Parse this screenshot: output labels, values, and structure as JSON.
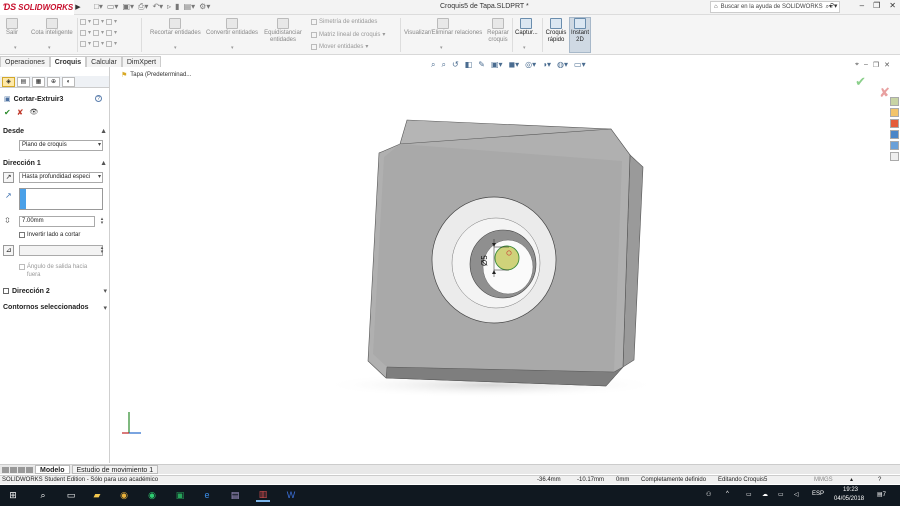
{
  "app": {
    "brand": "SOLIDWORKS",
    "document_title": "Croquis5 de Tapa.SLDPRT *",
    "help_search_placeholder": "Buscar en la ayuda de SOLIDWORKS"
  },
  "ribbon": {
    "buttons": [
      {
        "label": "Salir"
      },
      {
        "label": "Cota inteligente"
      },
      {
        "label": "Recortar entidades"
      },
      {
        "label": "Convertir entidades"
      },
      {
        "label": "Equidistanciar entidades"
      },
      {
        "label": "Visualizar/Eliminar relaciones"
      },
      {
        "label": "Reparar croquis"
      },
      {
        "label": "Captur..."
      },
      {
        "label": "Croquis rápido"
      },
      {
        "label": "Instant 2D"
      }
    ],
    "small_items": [
      {
        "label": "Simetría de entidades"
      },
      {
        "label": "Matriz lineal de croquis"
      },
      {
        "label": "Mover entidades"
      }
    ]
  },
  "command_tabs": [
    "Operaciones",
    "Croquis",
    "Calcular",
    "DimXpert"
  ],
  "property_manager": {
    "title": "Cortar-Extruir3",
    "desde": {
      "label": "Desde",
      "value": "Plano de croquis"
    },
    "direccion1": {
      "label": "Dirección 1",
      "end_condition": "Hasta profundidad especi",
      "depth": "7.00mm",
      "flip_label": "Invertir lado a cortar",
      "draft_label": "Ángulo de salida hacia fuera"
    },
    "direccion2": {
      "label": "Dirección 2"
    },
    "contornos": {
      "label": "Contornos seleccionados"
    }
  },
  "viewport": {
    "breadcrumb": "Tapa  (Predeterminad...",
    "dimension_label": "Ø5"
  },
  "bottom_tabs": [
    "Modelo",
    "Estudio de movimiento 1"
  ],
  "status_bar": {
    "edition": "SOLIDWORKS Student Edition - Sólo para uso académico",
    "x": "-36.4mm",
    "y": "-10.17mm",
    "z": "0mm",
    "state": "Completamente definido",
    "editing": "Editando Croquis5",
    "units": "MMGS"
  },
  "taskbar": {
    "lang": "ESP",
    "time": "19:23",
    "date": "04/05/2018",
    "notifications": "7"
  }
}
